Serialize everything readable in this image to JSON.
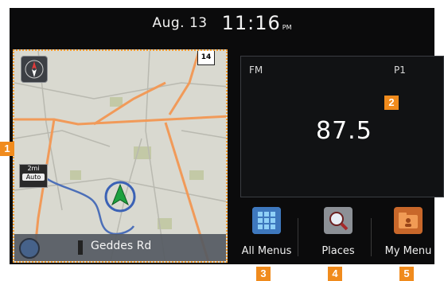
{
  "status": {
    "date": "Aug. 13",
    "time": "11:16",
    "ampm": "PM"
  },
  "map": {
    "route_shield": "14",
    "scale_distance": "2mi",
    "scale_mode": "Auto",
    "street_name": "Geddes Rd"
  },
  "radio": {
    "band": "FM",
    "preset": "P1",
    "frequency": "87.5"
  },
  "shortcuts": [
    {
      "label": "All Menus",
      "icon": "grid-menu-icon"
    },
    {
      "label": "Places",
      "icon": "search-places-icon"
    },
    {
      "label": "My Menu",
      "icon": "folder-icon"
    }
  ],
  "callouts": [
    "1",
    "2",
    "3",
    "4",
    "5"
  ],
  "colors": {
    "accent": "#f08b1d",
    "background": "#0b0b0c",
    "map": "#d8d8cf",
    "route": "#f19a59",
    "water": "#4c6fb8"
  }
}
